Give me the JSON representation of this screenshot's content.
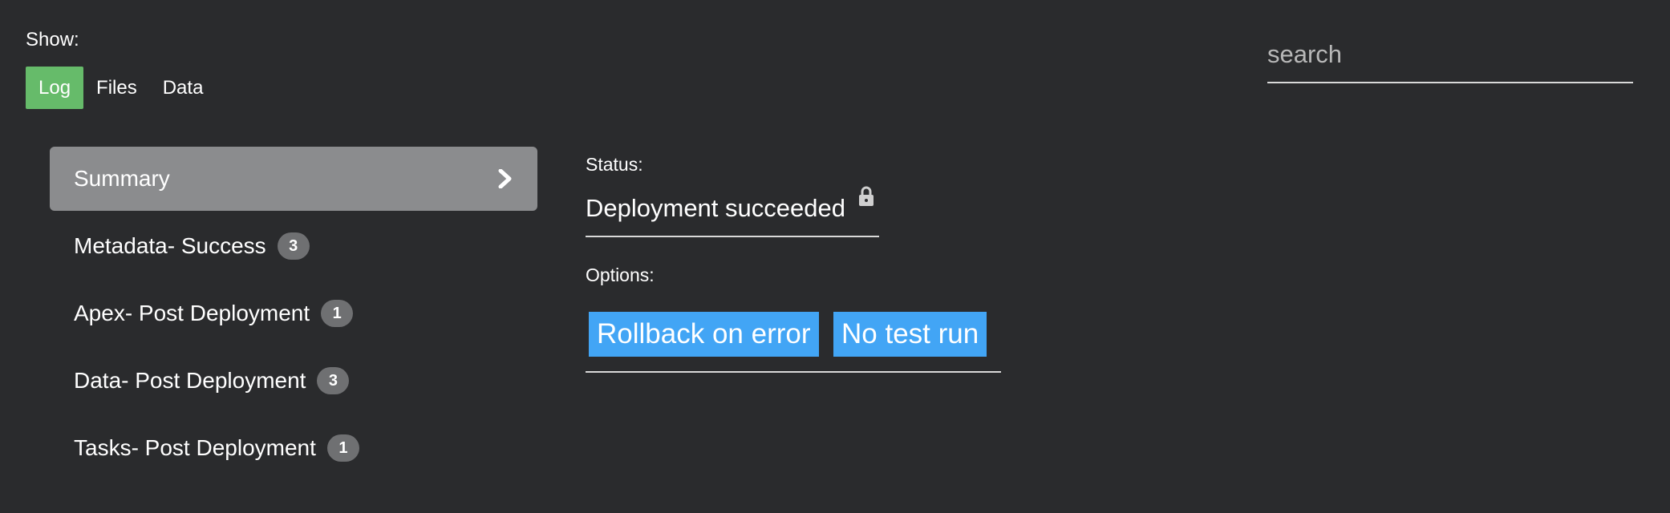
{
  "show": {
    "label": "Show:",
    "tabs": [
      {
        "label": "Log",
        "active": true
      },
      {
        "label": "Files",
        "active": false
      },
      {
        "label": "Data",
        "active": false
      }
    ]
  },
  "search": {
    "placeholder": "search",
    "value": ""
  },
  "nav": {
    "items": [
      {
        "label": "Summary",
        "badge": null,
        "active": true,
        "icon": "chevron-right-icon"
      },
      {
        "label": "Metadata- Success",
        "badge": "3",
        "active": false
      },
      {
        "label": "Apex- Post Deployment",
        "badge": "1",
        "active": false
      },
      {
        "label": "Data- Post Deployment",
        "badge": "3",
        "active": false
      },
      {
        "label": "Tasks- Post Deployment",
        "badge": "1",
        "active": false
      }
    ]
  },
  "detail": {
    "status_label": "Status:",
    "status_value": "Deployment succeeded",
    "status_icon": "lock-icon",
    "options_label": "Options:",
    "options": [
      "Rollback on error",
      "No test run"
    ]
  },
  "colors": {
    "background": "#2a2b2d",
    "active_tab": "#66bb6a",
    "active_nav": "#8b8c8e",
    "badge": "#6f7072",
    "chip": "#42a5f5"
  }
}
